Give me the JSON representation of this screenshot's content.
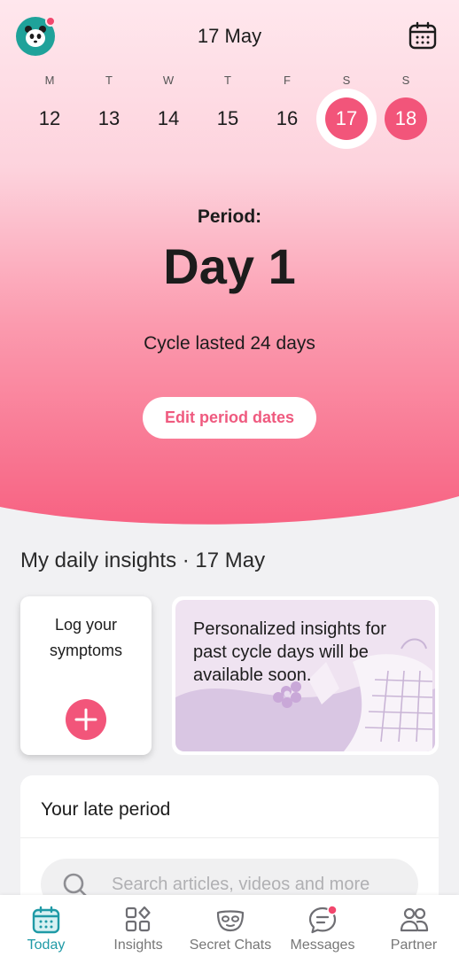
{
  "header": {
    "date_title": "17 May"
  },
  "week": {
    "letters": [
      "M",
      "T",
      "W",
      "T",
      "F",
      "S",
      "S"
    ],
    "days": [
      "12",
      "13",
      "14",
      "15",
      "16",
      "17",
      "18"
    ],
    "selected_day": "17",
    "period_days": [
      "17",
      "18"
    ]
  },
  "hero": {
    "period_label": "Period:",
    "period_day": "Day 1",
    "cycle_text": "Cycle lasted 24 days",
    "edit_button": "Edit period dates"
  },
  "insights": {
    "title": "My daily insights · 17 May",
    "log_card_line1": "Log your",
    "log_card_line2": "symptoms",
    "personalized_text": "Personalized insights for past cycle days will be available soon."
  },
  "late_period": {
    "title": "Your late period",
    "search_placeholder": "Search articles, videos and more"
  },
  "nav": {
    "today": "Today",
    "insights": "Insights",
    "secret_chats": "Secret Chats",
    "messages": "Messages",
    "partner": "Partner"
  },
  "colors": {
    "accent_pink": "#f2557a",
    "active_teal": "#1f9aa6",
    "avatar_teal": "#1fa29a"
  }
}
